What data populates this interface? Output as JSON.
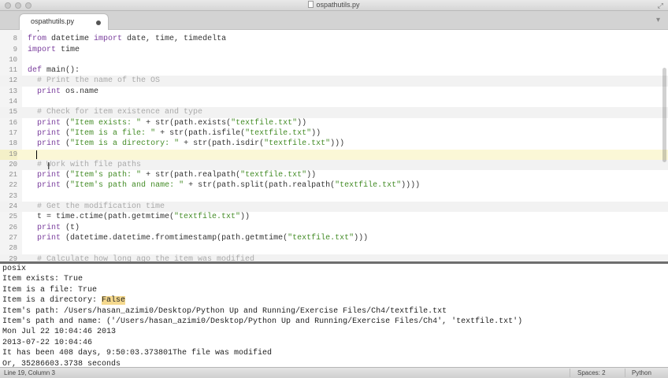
{
  "window": {
    "title": "ospathutils.py"
  },
  "tab": {
    "label": "ospathutils.py"
  },
  "colors": {
    "keyword": "#7a3e9d",
    "string": "#448c27",
    "comment": "#aaaaaa",
    "plain": "#333333"
  },
  "editor": {
    "current_line": 19,
    "lines": [
      {
        "num": "",
        "hl": false,
        "tokens": [
          {
            "t": "plain",
            "v": "import datetime"
          }
        ]
      },
      {
        "num": "8",
        "hl": false,
        "tokens": [
          {
            "t": "keyword",
            "v": "from"
          },
          {
            "t": "plain",
            "v": " datetime "
          },
          {
            "t": "keyword",
            "v": "import"
          },
          {
            "t": "plain",
            "v": " date, time, timedelta"
          }
        ]
      },
      {
        "num": "9",
        "hl": false,
        "tokens": [
          {
            "t": "keyword",
            "v": "import"
          },
          {
            "t": "plain",
            "v": " time"
          }
        ]
      },
      {
        "num": "10",
        "hl": false,
        "tokens": []
      },
      {
        "num": "11",
        "hl": false,
        "tokens": [
          {
            "t": "keyword",
            "v": "def"
          },
          {
            "t": "plain",
            "v": " main():"
          }
        ]
      },
      {
        "num": "12",
        "hl": true,
        "tokens": [
          {
            "t": "plain",
            "v": "  "
          },
          {
            "t": "comment",
            "v": "# Print the name of the OS"
          }
        ]
      },
      {
        "num": "13",
        "hl": false,
        "tokens": [
          {
            "t": "plain",
            "v": "  "
          },
          {
            "t": "keyword",
            "v": "print"
          },
          {
            "t": "plain",
            "v": " os.name"
          }
        ]
      },
      {
        "num": "14",
        "hl": false,
        "tokens": []
      },
      {
        "num": "15",
        "hl": true,
        "tokens": [
          {
            "t": "plain",
            "v": "  "
          },
          {
            "t": "comment",
            "v": "# Check for item existence and type"
          }
        ]
      },
      {
        "num": "16",
        "hl": false,
        "tokens": [
          {
            "t": "plain",
            "v": "  "
          },
          {
            "t": "keyword",
            "v": "print"
          },
          {
            "t": "plain",
            "v": " ("
          },
          {
            "t": "string",
            "v": "\"Item exists: \""
          },
          {
            "t": "plain",
            "v": " + str(path.exists("
          },
          {
            "t": "string",
            "v": "\"textfile.txt\""
          },
          {
            "t": "plain",
            "v": "))"
          }
        ]
      },
      {
        "num": "17",
        "hl": false,
        "tokens": [
          {
            "t": "plain",
            "v": "  "
          },
          {
            "t": "keyword",
            "v": "print"
          },
          {
            "t": "plain",
            "v": " ("
          },
          {
            "t": "string",
            "v": "\"Item is a file: \""
          },
          {
            "t": "plain",
            "v": " + str(path.isfile("
          },
          {
            "t": "string",
            "v": "\"textfile.txt\""
          },
          {
            "t": "plain",
            "v": "))"
          }
        ]
      },
      {
        "num": "18",
        "hl": false,
        "tokens": [
          {
            "t": "plain",
            "v": "  "
          },
          {
            "t": "keyword",
            "v": "print"
          },
          {
            "t": "plain",
            "v": " ("
          },
          {
            "t": "string",
            "v": "\"Item is a directory: \""
          },
          {
            "t": "plain",
            "v": " + str(path.isdir("
          },
          {
            "t": "string",
            "v": "\"textfile.txt\""
          },
          {
            "t": "plain",
            "v": ")))"
          }
        ]
      },
      {
        "num": "19",
        "hl": false,
        "tokens": []
      },
      {
        "num": "20",
        "hl": true,
        "tokens": [
          {
            "t": "plain",
            "v": "  "
          },
          {
            "t": "comment",
            "v": "# Work with file paths"
          }
        ]
      },
      {
        "num": "21",
        "hl": false,
        "tokens": [
          {
            "t": "plain",
            "v": "  "
          },
          {
            "t": "keyword",
            "v": "print"
          },
          {
            "t": "plain",
            "v": " ("
          },
          {
            "t": "string",
            "v": "\"Item's path: \""
          },
          {
            "t": "plain",
            "v": " + str(path.realpath("
          },
          {
            "t": "string",
            "v": "\"textfile.txt\""
          },
          {
            "t": "plain",
            "v": "))"
          }
        ]
      },
      {
        "num": "22",
        "hl": false,
        "tokens": [
          {
            "t": "plain",
            "v": "  "
          },
          {
            "t": "keyword",
            "v": "print"
          },
          {
            "t": "plain",
            "v": " ("
          },
          {
            "t": "string",
            "v": "\"Item's path and name: \""
          },
          {
            "t": "plain",
            "v": " + str(path.split(path.realpath("
          },
          {
            "t": "string",
            "v": "\"textfile.txt\""
          },
          {
            "t": "plain",
            "v": "))))"
          }
        ]
      },
      {
        "num": "23",
        "hl": false,
        "tokens": []
      },
      {
        "num": "24",
        "hl": true,
        "tokens": [
          {
            "t": "plain",
            "v": "  "
          },
          {
            "t": "comment",
            "v": "# Get the modification time"
          }
        ]
      },
      {
        "num": "25",
        "hl": false,
        "tokens": [
          {
            "t": "plain",
            "v": "  t = time.ctime(path.getmtime("
          },
          {
            "t": "string",
            "v": "\"textfile.txt\""
          },
          {
            "t": "plain",
            "v": "))"
          }
        ]
      },
      {
        "num": "26",
        "hl": false,
        "tokens": [
          {
            "t": "plain",
            "v": "  "
          },
          {
            "t": "keyword",
            "v": "print"
          },
          {
            "t": "plain",
            "v": " (t)"
          }
        ]
      },
      {
        "num": "27",
        "hl": false,
        "tokens": [
          {
            "t": "plain",
            "v": "  "
          },
          {
            "t": "keyword",
            "v": "print"
          },
          {
            "t": "plain",
            "v": " (datetime.datetime.fromtimestamp(path.getmtime("
          },
          {
            "t": "string",
            "v": "\"textfile.txt\""
          },
          {
            "t": "plain",
            "v": ")))"
          }
        ]
      },
      {
        "num": "28",
        "hl": false,
        "tokens": []
      },
      {
        "num": "29",
        "hl": true,
        "tokens": [
          {
            "t": "plain",
            "v": "  "
          },
          {
            "t": "comment",
            "v": "# Calculate how long ago the item was modified"
          }
        ]
      }
    ]
  },
  "console": {
    "lines": [
      {
        "text": "posix"
      },
      {
        "text": "Item exists: True"
      },
      {
        "text": "Item is a file: True"
      },
      {
        "text": "Item is a directory: ",
        "highlight": "False"
      },
      {
        "text": "Item's path: /Users/hasan_azimi0/Desktop/Python Up and Running/Exercise Files/Ch4/textfile.txt"
      },
      {
        "text": "Item's path and name: ('/Users/hasan_azimi0/Desktop/Python Up and Running/Exercise Files/Ch4', 'textfile.txt')"
      },
      {
        "text": "Mon Jul 22 10:04:46 2013"
      },
      {
        "text": "2013-07-22 10:04:46"
      },
      {
        "text": "It has been 408 days, 9:50:03.373801The file was modified"
      },
      {
        "text": "Or, 35286603.3738 seconds"
      }
    ]
  },
  "status": {
    "position": "Line 19, Column 3",
    "spaces": "Spaces: 2",
    "syntax": "Python"
  }
}
